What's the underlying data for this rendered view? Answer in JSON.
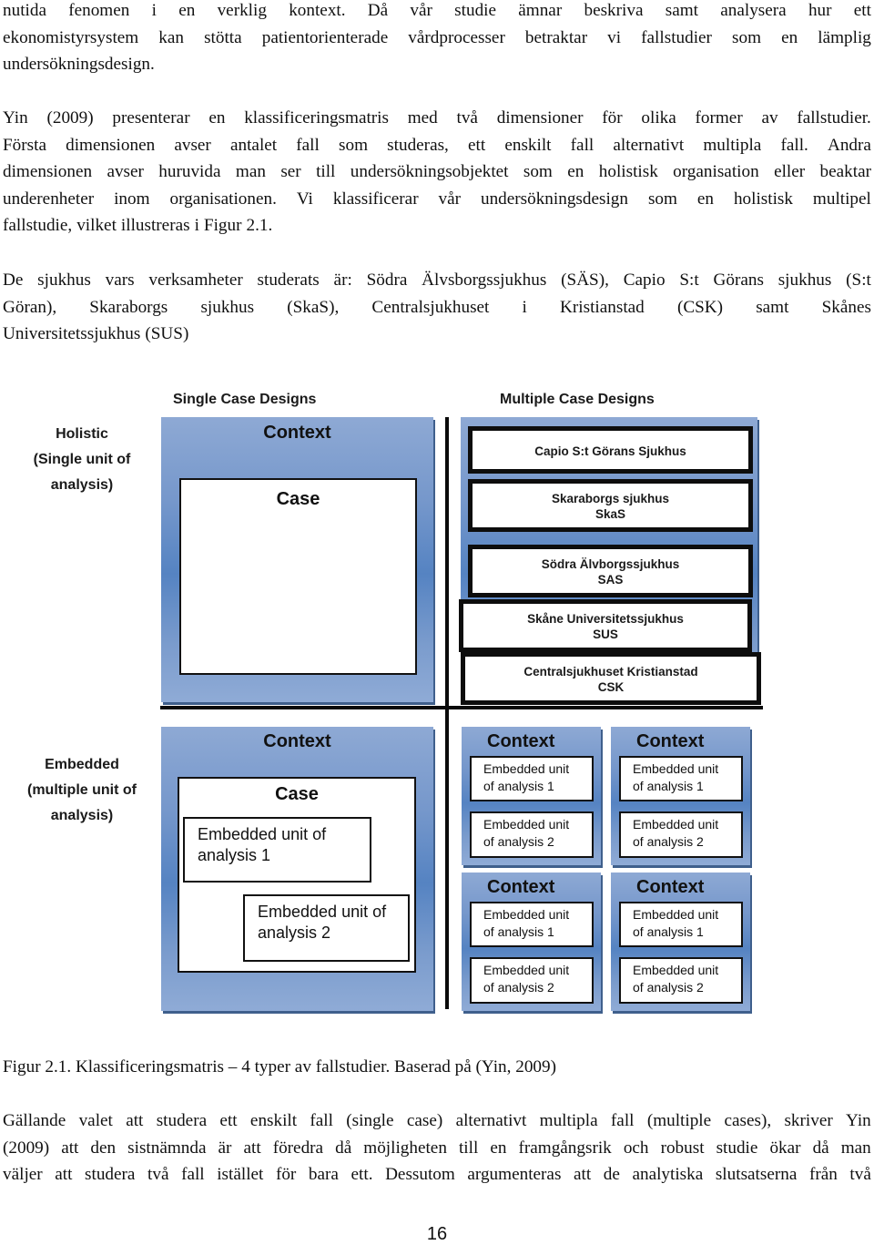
{
  "paragraphs": {
    "intro": [
      [
        "nutida",
        "fenomen",
        "i",
        "en",
        "verklig",
        "kontext.",
        "Då",
        "vår",
        "studie",
        "ämnar",
        "beskriva",
        "samt",
        "analysera",
        "hur",
        "ett"
      ],
      [
        "ekonomistyrsystem",
        "kan",
        "stötta",
        "patientorienterade",
        "vårdprocesser",
        "betraktar",
        "vi",
        "fallstudier",
        "som",
        "en",
        "lämplig"
      ],
      [
        "undersökningsdesign."
      ]
    ],
    "yin": [
      [
        "Yin",
        "(2009)",
        "presenterar",
        "en",
        "klassificeringsmatris",
        "med",
        "två",
        "dimensioner",
        "för",
        "olika",
        "former",
        "av",
        "fallstudier."
      ],
      [
        "Första",
        "dimensionen",
        "avser",
        "antalet",
        "fall",
        "som",
        "studeras,",
        "ett",
        "enskilt",
        "fall",
        "alternativt",
        "multipla",
        "fall.",
        "Andra"
      ],
      [
        "dimensionen",
        "avser",
        "huruvida",
        "man",
        "ser",
        "till",
        "undersökningsobjektet",
        "som",
        "en",
        "holistisk",
        "organisation",
        "eller",
        "beaktar"
      ],
      [
        "underenheter",
        "inom",
        "organisationen.",
        "Vi",
        "klassificerar",
        "vår",
        "undersökningsdesign",
        "som",
        "en",
        "holistisk",
        "multipel"
      ],
      [
        "fallstudie,",
        "vilket",
        "illustreras",
        "i",
        "Figur",
        "2.1."
      ]
    ],
    "hospitals": [
      [
        "De",
        "sjukhus",
        "vars",
        "verksamheter",
        "studerats",
        "är:",
        "Södra",
        "Älvsborgssjukhus",
        "(SÄS),",
        "Capio",
        "S:t",
        "Görans",
        "sjukhus",
        "(S:t"
      ],
      [
        "Göran),",
        "Skaraborgs",
        "sjukhus",
        "(SkaS),",
        "Centralsjukhuset",
        "i",
        "Kristianstad",
        "(CSK)",
        "samt",
        "Skånes"
      ],
      [
        "Universitetssjukhus",
        "(SUS)"
      ]
    ],
    "after": [
      [
        "Gällande",
        "valet",
        "att",
        "studera",
        "ett",
        "enskilt",
        "fall",
        "(single",
        "case)",
        "alternativt",
        "multipla",
        "fall",
        "(multiple",
        "cases),",
        "skriver",
        "Yin"
      ],
      [
        "(2009)",
        "att",
        "den",
        "sistnämnda",
        "är",
        "att",
        "föredra",
        "då",
        "möjligheten",
        "till",
        "en",
        "framgångsrik",
        "och",
        "robust",
        "studie",
        "ökar",
        "då",
        "man"
      ],
      [
        "väljer",
        "att",
        "studera",
        "två",
        "fall",
        "istället",
        "för",
        "bara",
        "ett.",
        "Dessutom",
        "argumenteras",
        "att",
        "de",
        "analytiska",
        "slutsatserna",
        "från",
        "två"
      ]
    ]
  },
  "figure": {
    "col_headers": {
      "single": "Single Case Designs",
      "multiple": "Multiple Case Designs"
    },
    "row_labels": {
      "holistic": [
        "Holistic",
        "(Single unit of",
        "analysis)"
      ],
      "embedded": [
        "Embedded",
        "(multiple unit of",
        "analysis)"
      ]
    },
    "single_holistic": {
      "context": "Context",
      "case": "Case"
    },
    "multiple_holistic": {
      "cases": [
        {
          "name": "Capio S:t Görans Sjukhus",
          "abbr": ""
        },
        {
          "name": "Skaraborgs sjukhus",
          "abbr": "SkaS"
        },
        {
          "name": "Södra Älvborgssjukhus",
          "abbr": "SAS"
        },
        {
          "name": "Skåne Universitetssjukhus",
          "abbr": "SUS"
        },
        {
          "name": "Centralsjukhuset Kristianstad",
          "abbr": "CSK"
        }
      ]
    },
    "single_embedded": {
      "context": "Context",
      "case": "Case",
      "units": [
        "Embedded unit of analysis 1",
        "Embedded unit of analysis 2"
      ],
      "unit_lines": [
        [
          "Embedded unit of",
          "analysis 1"
        ],
        [
          "Embedded unit of",
          "analysis 2"
        ]
      ]
    },
    "multiple_embedded": {
      "context": "Context",
      "unit_lines": [
        [
          "Embedded unit",
          "of analysis 1"
        ],
        [
          "Embedded unit",
          "of analysis 2"
        ]
      ],
      "grid_count": 4
    },
    "colors": {
      "context_fill": "#8fabd6",
      "context_edge": "#5683c0",
      "shadow": "#3f5f8c",
      "axis": "#0a0a0a"
    }
  },
  "caption": "Figur 2.1. Klassificeringsmatris – 4 typer av fallstudier. Baserad på (Yin, 2009)",
  "page_number": "16"
}
